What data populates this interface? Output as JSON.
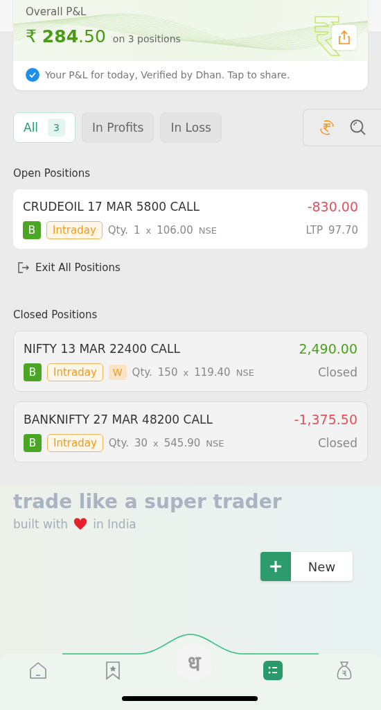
{
  "pnl": {
    "title": "Overall P&L",
    "currency": "₹",
    "amount_whole": "284",
    "amount_decimal": ".50",
    "positions_note": "on 3 positions",
    "verified_note": "Your P&L for today, Verified by Dhan. Tap to share."
  },
  "filters": [
    {
      "label": "All",
      "count": "3",
      "selected": true
    },
    {
      "label": "In Profits",
      "selected": false
    },
    {
      "label": "In Loss",
      "selected": false
    }
  ],
  "open_positions": {
    "title": "Open Positions",
    "items": [
      {
        "symbol": "CRUDEOIL 17 MAR 5800 CALL",
        "pnl": "-830.00",
        "color": "#e0505a",
        "side": "B",
        "product": "Intraday",
        "qty_label": "Qty.",
        "qty": "1",
        "times": "x",
        "price": "106.00",
        "exchange": "NSE",
        "ltp_label": "LTP",
        "ltp": "97.70"
      }
    ]
  },
  "exit_all": "Exit All Positions",
  "closed_positions": {
    "title": "Closed Positions",
    "items": [
      {
        "symbol": "NIFTY 13 MAR 22400 CALL",
        "pnl": "2,490.00",
        "color": "#48a215",
        "side": "B",
        "product": "Intraday",
        "flag": "W",
        "qty_label": "Qty.",
        "qty": "150",
        "times": "x",
        "price": "119.40",
        "exchange": "NSE",
        "status": "Closed"
      },
      {
        "symbol": "BANKNIFTY 27 MAR 48200 CALL",
        "pnl": "-1,375.50",
        "color": "#e0505a",
        "side": "B",
        "product": "Intraday",
        "qty_label": "Qty.",
        "qty": "30",
        "times": "x",
        "price": "545.90",
        "exchange": "NSE",
        "status": "Closed"
      }
    ]
  },
  "footer": {
    "tagline": "trade like a super trader",
    "built_with": "built with",
    "in_india": "in India"
  },
  "new_button": {
    "label": "New"
  },
  "nav": {
    "logo": "ध",
    "items": [
      {
        "kind": "home",
        "selected": false
      },
      {
        "kind": "watchlist",
        "selected": false
      },
      {
        "kind": "logo"
      },
      {
        "kind": "positions",
        "selected": true
      },
      {
        "kind": "funds",
        "selected": false
      }
    ]
  }
}
